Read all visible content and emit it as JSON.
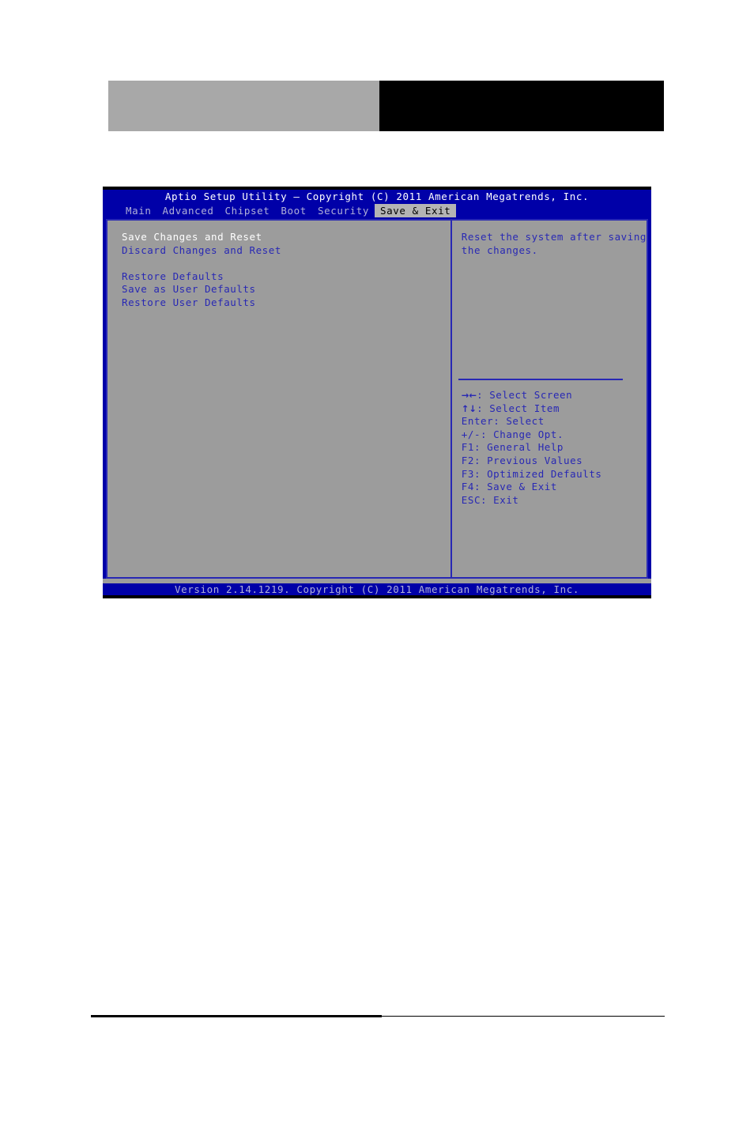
{
  "page_header": {
    "left_block_color": "#a8a8a8",
    "right_block_color": "#000000"
  },
  "bios": {
    "title": "Aptio Setup Utility – Copyright (C) 2011 American Megatrends, Inc.",
    "version_bar": "Version 2.14.1219. Copyright (C) 2011 American Megatrends, Inc.",
    "colors": {
      "screen_blue": "#0000a8",
      "panel_gray": "#9c9c9c",
      "border_blue": "#2828b4",
      "text_blue": "#2828b4",
      "text_selected": "#ffffff",
      "tab_inactive": "#b0b0d8",
      "tab_active_bg": "#b4b4b4",
      "tab_active_text": "#000000"
    },
    "menu_tabs": [
      {
        "label": "Main",
        "active": false
      },
      {
        "label": "Advanced",
        "active": false
      },
      {
        "label": "Chipset",
        "active": false
      },
      {
        "label": "Boot",
        "active": false
      },
      {
        "label": "Security",
        "active": false
      },
      {
        "label": "Save & Exit",
        "active": true
      }
    ],
    "options": [
      {
        "label": "Save Changes and Reset",
        "selected": true
      },
      {
        "label": "Discard Changes and Reset",
        "selected": false
      },
      {
        "label": "",
        "spacer": true
      },
      {
        "label": "Restore Defaults",
        "selected": false
      },
      {
        "label": "Save as User Defaults",
        "selected": false
      },
      {
        "label": "Restore User Defaults",
        "selected": false
      }
    ],
    "help": {
      "line1": "Reset the system after saving",
      "line2": "the changes."
    },
    "legend": [
      {
        "key": "→←",
        "text": ": Select Screen",
        "icon": "arrow-left-right-icon"
      },
      {
        "key": "↑↓",
        "text": ": Select Item",
        "icon": "arrow-up-down-icon"
      },
      {
        "key": "Enter",
        "text": ": Select",
        "icon": ""
      },
      {
        "key": "+/-",
        "text": ": Change Opt.",
        "icon": ""
      },
      {
        "key": "F1",
        "text": ": General Help",
        "icon": ""
      },
      {
        "key": "F2",
        "text": ": Previous Values",
        "icon": ""
      },
      {
        "key": "F3",
        "text": ": Optimized Defaults",
        "icon": ""
      },
      {
        "key": "F4",
        "text": ": Save & Exit",
        "icon": ""
      },
      {
        "key": "ESC",
        "text": ": Exit",
        "icon": ""
      }
    ]
  }
}
